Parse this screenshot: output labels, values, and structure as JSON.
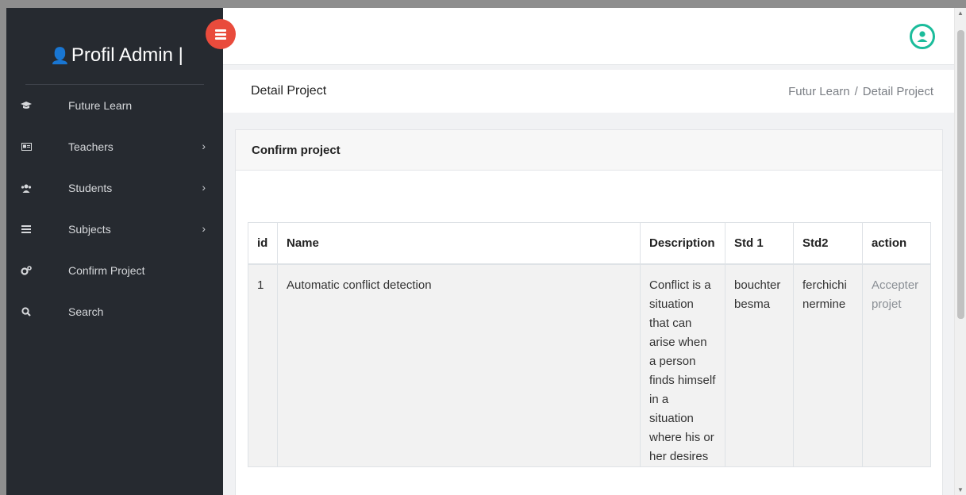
{
  "sidebar": {
    "brand": "Profil Admin |",
    "items": [
      {
        "label": "Future Learn",
        "icon": "graduation-cap-icon",
        "has_submenu": false
      },
      {
        "label": "Teachers",
        "icon": "id-card-icon",
        "has_submenu": true
      },
      {
        "label": "Students",
        "icon": "users-icon",
        "has_submenu": true
      },
      {
        "label": "Subjects",
        "icon": "list-icon",
        "has_submenu": true
      },
      {
        "label": "Confirm Project",
        "icon": "gears-icon",
        "has_submenu": false
      },
      {
        "label": "Search",
        "icon": "search-icon",
        "has_submenu": false
      }
    ]
  },
  "header": {
    "title": "Detail Project",
    "breadcrumb": [
      "Futur Learn",
      "Detail Project"
    ]
  },
  "card": {
    "title": "Confirm project",
    "table": {
      "columns": [
        "id",
        "Name",
        "Description",
        "Std 1",
        "Std2",
        "action"
      ],
      "rows": [
        {
          "id": "1",
          "name": "Automatic conflict detection",
          "description": "Conflict is a situation that can arise when a person finds himself in a situation where his or her desires",
          "std1": "bouchter besma",
          "std2": "ferchichi nermine",
          "action": "Accepter projet"
        }
      ]
    }
  },
  "colors": {
    "sidebar_bg": "#262a30",
    "toggle_button": "#e94b3c",
    "user_icon": "#1bbc9b"
  }
}
